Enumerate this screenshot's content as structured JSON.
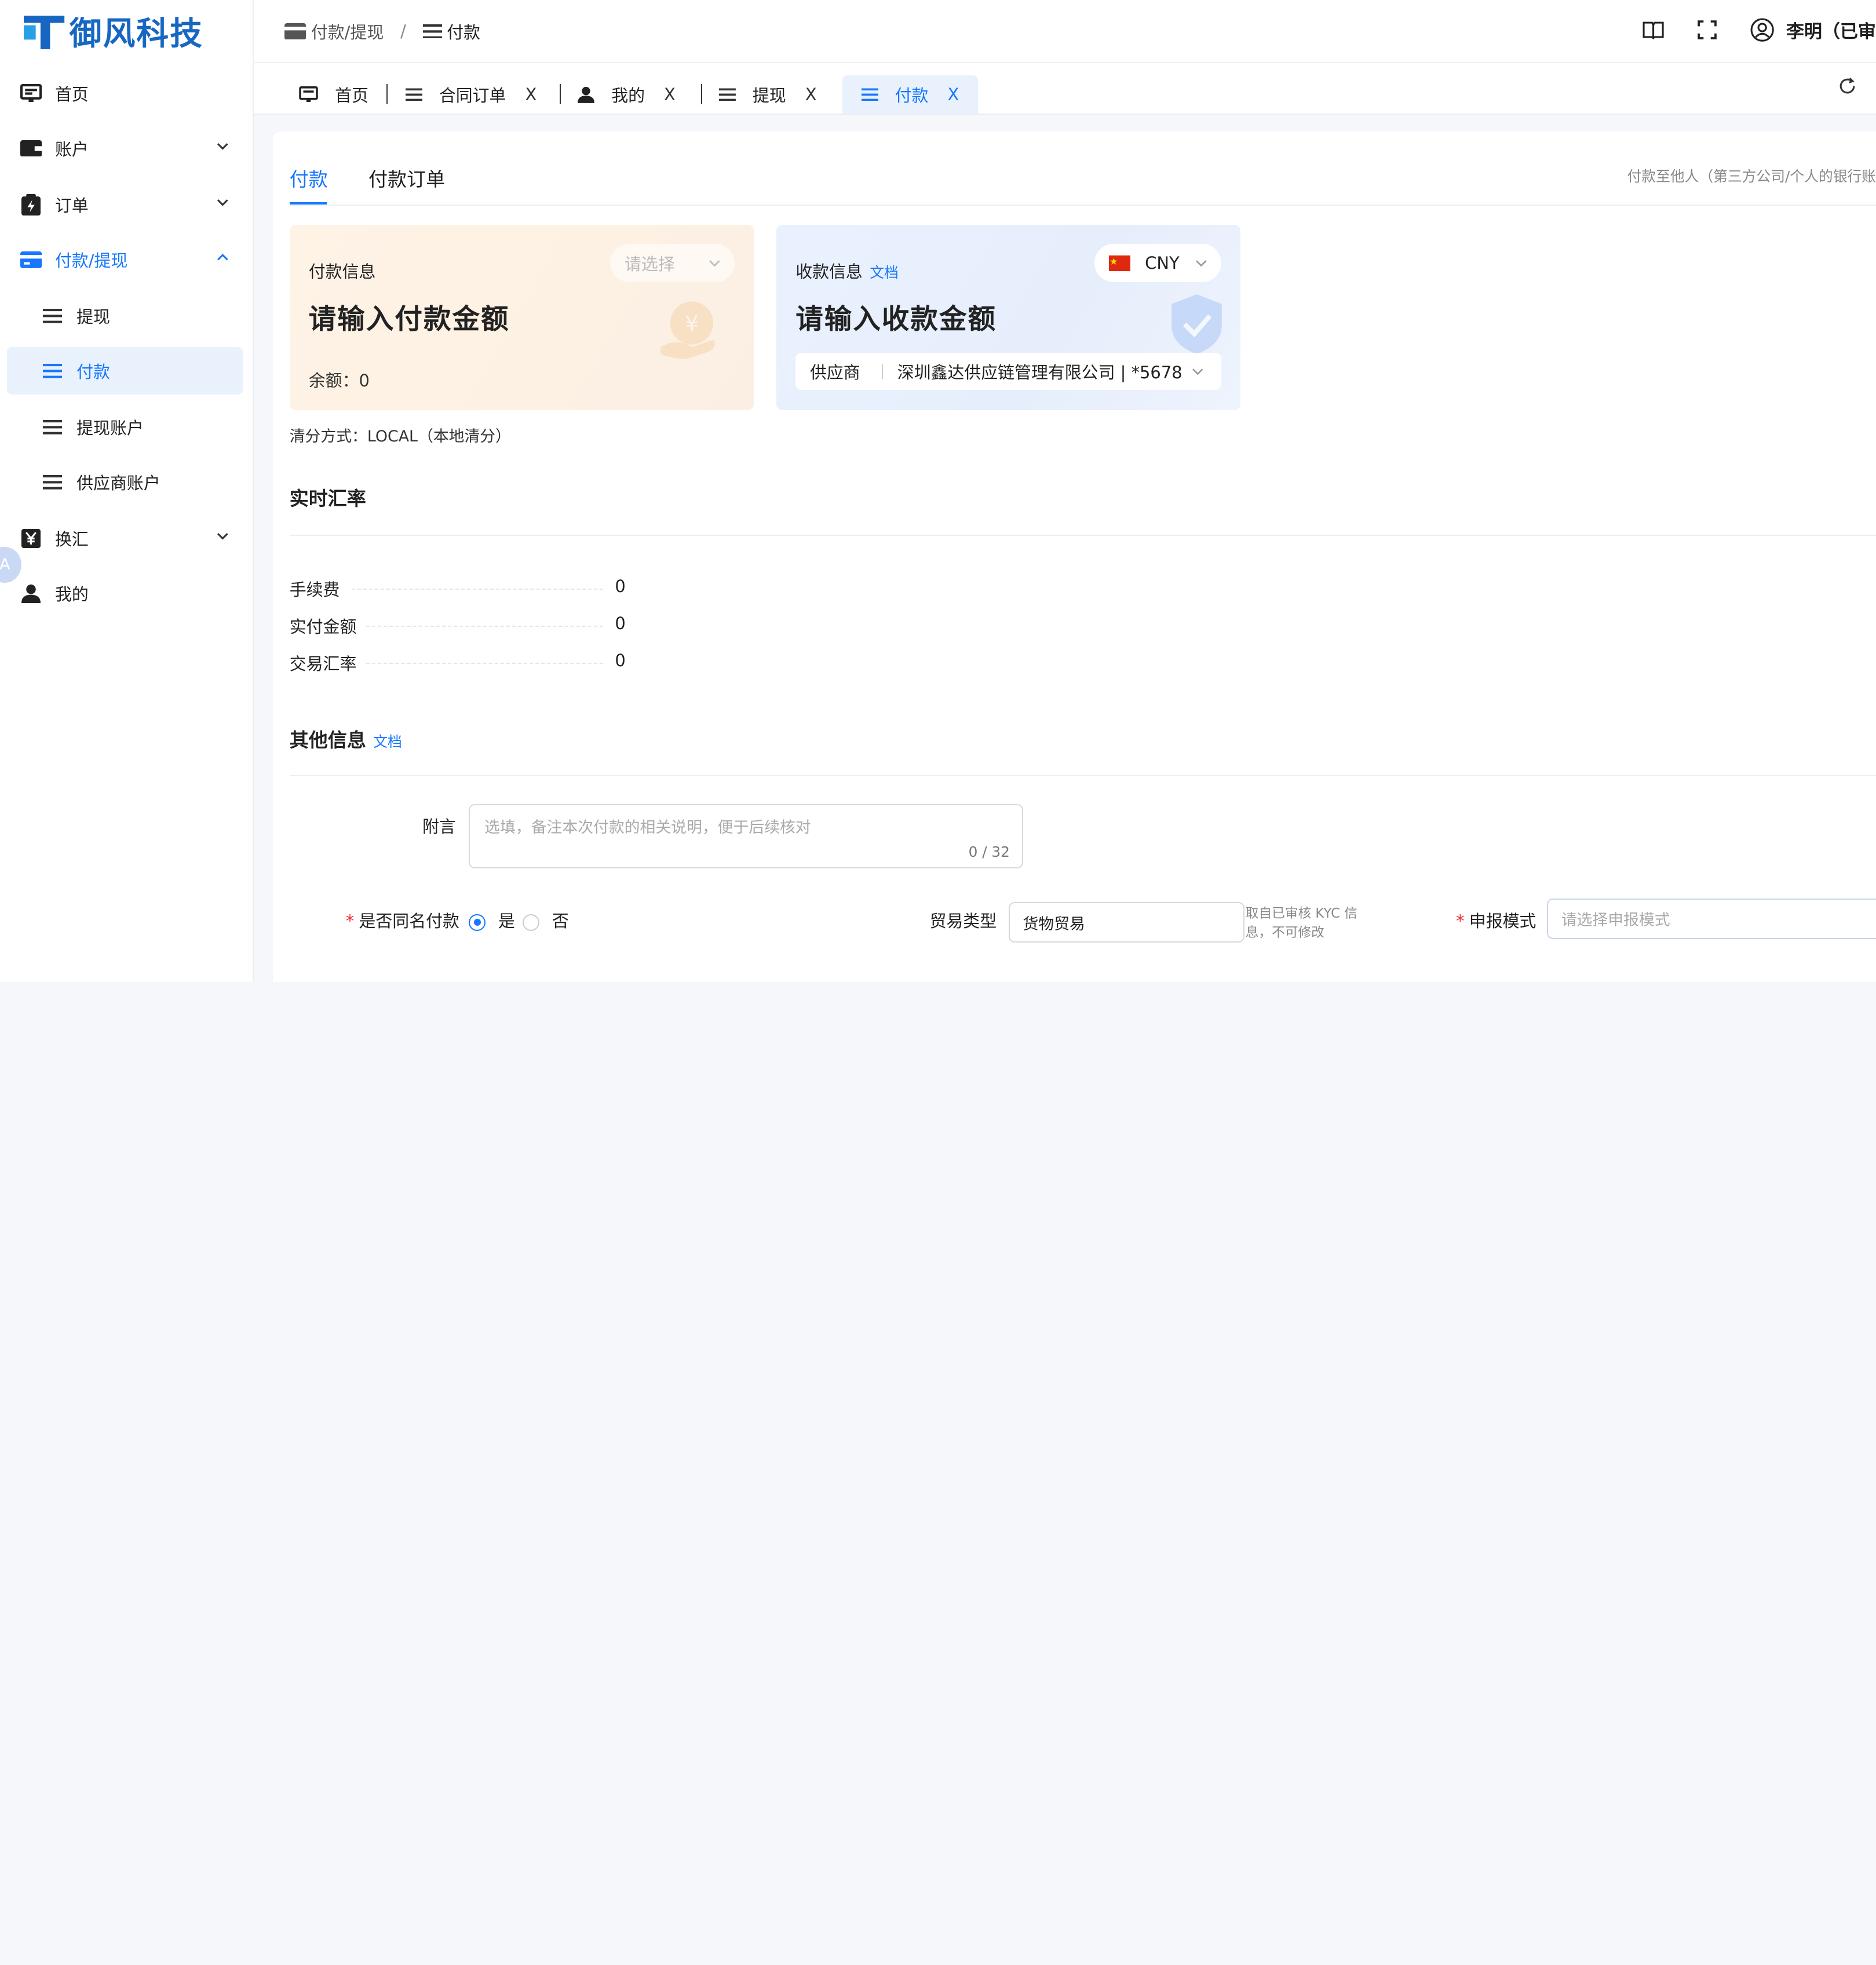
{
  "brand": {
    "name": "御风科技",
    "color": "#1767c2"
  },
  "sidebar": {
    "items": [
      {
        "label": "首页",
        "icon": "monitor-icon"
      },
      {
        "label": "账户",
        "icon": "wallet-icon"
      },
      {
        "label": "订单",
        "icon": "clipboard-icon"
      },
      {
        "label": "付款/提现",
        "icon": "card-icon",
        "expanded": true
      },
      {
        "label": "提现",
        "icon": "menu-icon"
      },
      {
        "label": "付款",
        "icon": "menu-icon",
        "active": true
      },
      {
        "label": "提现账户",
        "icon": "menu-icon"
      },
      {
        "label": "供应商账户",
        "icon": "menu-icon"
      },
      {
        "label": "换汇",
        "icon": "yen-icon"
      },
      {
        "label": "我的",
        "icon": "user-icon"
      }
    ],
    "floating_badge": "A"
  },
  "header": {
    "breadcrumb": [
      "付款/提现",
      "付款"
    ],
    "breadcrumb_sep": "/",
    "user": "李明（已审"
  },
  "tabs": [
    {
      "label": "首页",
      "closable": false
    },
    {
      "label": "合同订单",
      "closable": true
    },
    {
      "label": "我的",
      "closable": true
    },
    {
      "label": "提现",
      "closable": true
    },
    {
      "label": "付款",
      "closable": true,
      "active": true
    }
  ],
  "tab_close": "X",
  "page": {
    "tabs": [
      "付款",
      "付款订单"
    ],
    "hint": "付款至他人（第三方公司/个人的银行账"
  },
  "pay_card": {
    "title": "付款信息",
    "select_placeholder": "请选择",
    "amount_placeholder": "请输入付款金额",
    "balance": "余额：0"
  },
  "receive_card": {
    "title": "收款信息",
    "doc_link": "文档",
    "currency": "CNY",
    "amount_placeholder": "请输入收款金额",
    "supplier_label": "供应商",
    "supplier_value": "深圳鑫达供应链管理有限公司 | *5678"
  },
  "clearing": "清分方式：LOCAL（本地清分）",
  "rate_section": {
    "title": "实时汇率",
    "rows": [
      {
        "label": "手续费",
        "value": "0"
      },
      {
        "label": "实付金额",
        "value": "0"
      },
      {
        "label": "交易汇率",
        "value": "0"
      }
    ]
  },
  "other_section": {
    "title": "其他信息",
    "doc_link": "文档",
    "remark_label": "附言",
    "remark_placeholder": "选填，备注本次付款的相关说明，便于后续核对",
    "remark_count": "0 / 32",
    "same_name_label": "是否同名付款",
    "same_name_yes": "是",
    "same_name_no": "否",
    "trade_type_label": "贸易类型",
    "trade_type_value": "货物贸易",
    "trade_note": "取自已审核 KYC 信息，不可修改",
    "declare_label": "申报模式",
    "declare_placeholder": "请选择申报模式"
  },
  "colors": {
    "accent": "#1677ff",
    "active_bg": "#e9f1fd",
    "required": "#ee3333"
  }
}
